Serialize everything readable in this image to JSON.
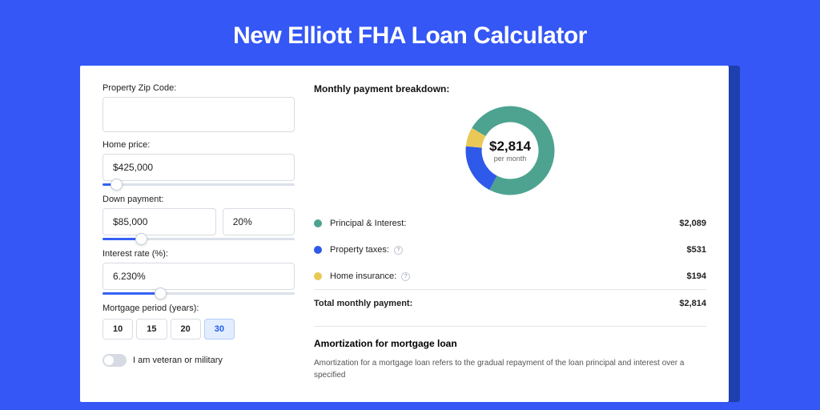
{
  "title": "New Elliott FHA Loan Calculator",
  "form": {
    "zip_label": "Property Zip Code:",
    "zip_value": "",
    "home_price_label": "Home price:",
    "home_price_value": "$425,000",
    "home_price_slider_pct": 7,
    "down_label": "Down payment:",
    "down_amount": "$85,000",
    "down_pct": "20%",
    "down_slider_pct": 20,
    "rate_label": "Interest rate (%):",
    "rate_value": "6.230%",
    "rate_slider_pct": 30,
    "period_label": "Mortgage period (years):",
    "periods": [
      "10",
      "15",
      "20",
      "30"
    ],
    "period_active_index": 3,
    "veteran_label": "I am veteran or military",
    "veteran_on": false
  },
  "results": {
    "breakdown_title": "Monthly payment breakdown:",
    "center_amount": "$2,814",
    "center_sub": "per month",
    "rows": [
      {
        "swatch": "#4da38f",
        "label": "Principal & Interest:",
        "help": false,
        "value": "$2,089"
      },
      {
        "swatch": "#2f59e8",
        "label": "Property taxes:",
        "help": true,
        "value": "$531"
      },
      {
        "swatch": "#e9c856",
        "label": "Home insurance:",
        "help": true,
        "value": "$194"
      }
    ],
    "total_label": "Total monthly payment:",
    "total_value": "$2,814"
  },
  "amort": {
    "title": "Amortization for mortgage loan",
    "text": "Amortization for a mortgage loan refers to the gradual repayment of the loan principal and interest over a specified"
  },
  "chart_data": {
    "type": "pie",
    "title": "Monthly payment breakdown",
    "total_label": "$2,814 per month",
    "series": [
      {
        "name": "Principal & Interest",
        "value": 2089,
        "color": "#4da38f"
      },
      {
        "name": "Property taxes",
        "value": 531,
        "color": "#2f59e8"
      },
      {
        "name": "Home insurance",
        "value": 194,
        "color": "#e9c856"
      }
    ]
  }
}
